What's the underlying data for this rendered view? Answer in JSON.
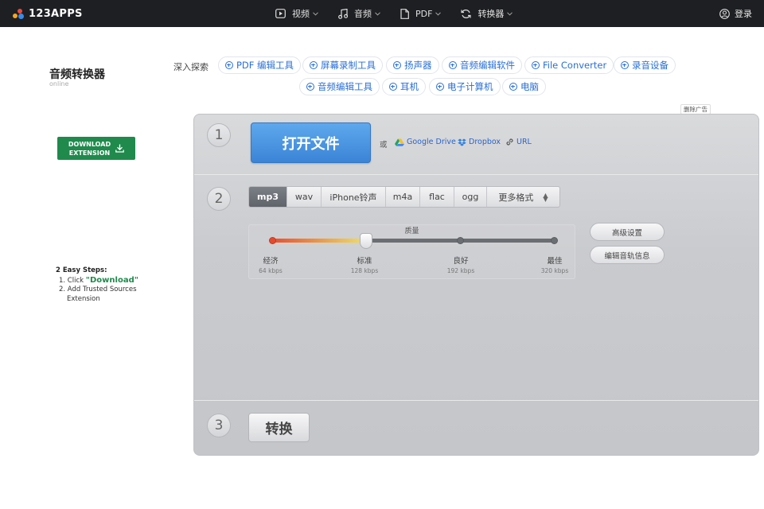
{
  "brand": {
    "logo_text": "123APPS"
  },
  "nav": {
    "items": [
      {
        "label": "视频",
        "icon": "video-icon"
      },
      {
        "label": "音频",
        "icon": "music-note-icon"
      },
      {
        "label": "PDF",
        "icon": "document-icon"
      },
      {
        "label": "转换器",
        "icon": "convert-icon"
      }
    ],
    "login": "登录"
  },
  "left": {
    "app_title": "音频转换器",
    "app_subtitle": "online",
    "download_btn": {
      "line1": "DOWNLOAD",
      "line2": "EXTENSION"
    },
    "steps": {
      "heading": "2 Easy Steps:",
      "step1_prefix": "1. Click ",
      "step1_word": "\"Download\"",
      "step2_line1": "2. Add Trusted Sources",
      "step2_line2": "Extension"
    }
  },
  "explore": {
    "label": "深入探索",
    "chips": [
      "PDF 编辑工具",
      "屏幕录制工具",
      "扬声器",
      "音频编辑软件",
      "File Converter",
      "录音设备",
      "音频编辑工具",
      "耳机",
      "电子计算机",
      "电脑"
    ]
  },
  "remove_ad": "删除广告",
  "step1": {
    "number": "1",
    "open_button": "打开文件",
    "or_text": "或",
    "sources": [
      "Google Drive",
      "Dropbox",
      "URL"
    ]
  },
  "step2": {
    "number": "2",
    "formats": [
      "mp3",
      "wav",
      "iPhone铃声",
      "m4a",
      "flac",
      "ogg",
      "更多格式"
    ],
    "active_format": "mp3",
    "quality": {
      "title": "质量",
      "levels": [
        {
          "name": "经济",
          "kbps": "64 kbps"
        },
        {
          "name": "标准",
          "kbps": "128 kbps"
        },
        {
          "name": "良好",
          "kbps": "192 kbps"
        },
        {
          "name": "最佳",
          "kbps": "320 kbps"
        }
      ],
      "selected_fraction": 0.33
    },
    "advanced_button": "高级设置",
    "edit_track_button": "编辑音轨信息"
  },
  "step3": {
    "number": "3",
    "convert_button": "转换"
  },
  "colors": {
    "accent_blue": "#3b84d6",
    "download_green": "#1f8a4c",
    "topbar": "#1e1f22"
  }
}
